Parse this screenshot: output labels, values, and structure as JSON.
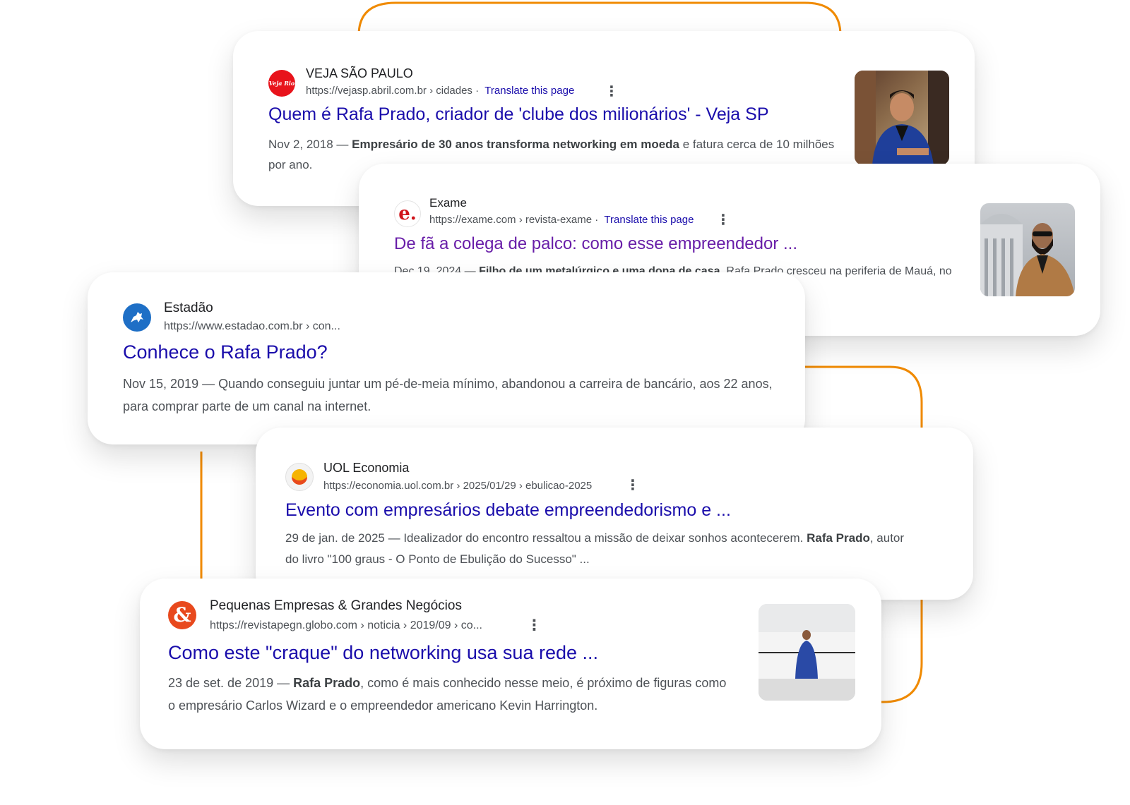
{
  "colors": {
    "accent": "#f08a00",
    "link": "#1a0dab",
    "visited": "#681da8",
    "snippet": "#4d5156"
  },
  "results": [
    {
      "site": "VEJA SÃO PAULO",
      "favicon_text": "Veja Rio",
      "url": "https://vejasp.abril.com.br › cidades",
      "translate": "Translate this page",
      "title": "Quem é Rafa Prado, criador de 'clube dos milionários' - Veja SP",
      "date": "Nov 2, 2018 —",
      "bold": "Empresário de 30 anos transforma networking em moeda",
      "rest": "e fatura cerca de 10 milhões por ano."
    },
    {
      "site": "Exame",
      "favicon_text": "e.",
      "url": "https://exame.com › revista-exame",
      "translate": "Translate this page",
      "title": "De fã a colega de palco: como esse empreendedor ...",
      "date": "Dec 19, 2024 —",
      "bold": "Filho de um metalúrgico e uma dona de casa",
      "rest": ", Rafa Prado cresceu na periferia de Mauá, no ABC Paulista. Por ali, sempre ouviu que grandes ..."
    },
    {
      "site": "Estadão",
      "url": "https://www.estadao.com.br › con...",
      "title": "Conhece o Rafa Prado?",
      "date": "Nov 15, 2019 —",
      "rest": "Quando conseguiu juntar um pé-de-meia mínimo, abandonou a carreira de bancário, aos 22 anos, para comprar parte de um canal na internet."
    },
    {
      "site": "UOL Economia",
      "url": "https://economia.uol.com.br › 2025/01/29 › ebulicao-2025",
      "title": "Evento com empresários debate empreendedorismo e ...",
      "date": "29 de jan. de 2025 —",
      "pre": "Idealizador do encontro ressaltou a missão de deixar sonhos acontecerem.",
      "bold": "Rafa Prado",
      "rest": ", autor do livro \"100 graus - O Ponto de Ebulição do Sucesso\" ..."
    },
    {
      "site": "Pequenas Empresas & Grandes Negócios",
      "favicon_text": "&",
      "url": "https://revistapegn.globo.com › noticia › 2019/09 › co...",
      "title": "Como este \"craque\" do networking usa sua rede ...",
      "date": "23 de set. de 2019 —",
      "bold": "Rafa Prado",
      "rest": ", como é mais conhecido nesse meio, é próximo de figuras como o empresário Carlos Wizard e o empreendedor americano Kevin Harrington."
    }
  ]
}
